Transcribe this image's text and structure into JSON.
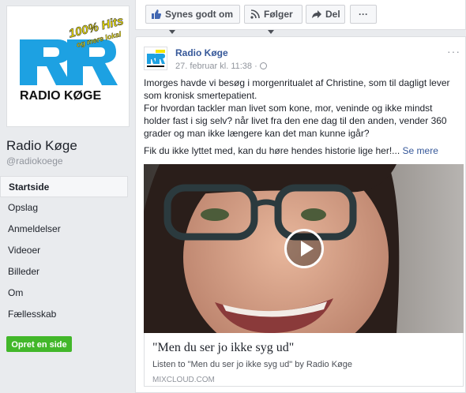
{
  "page": {
    "name": "Radio Køge",
    "handle": "@radiokoege"
  },
  "logo": {
    "slogan_line1": "100% Hits",
    "slogan_line2": "og mere lokal",
    "wordmark": "RADIO KØGE"
  },
  "nav": {
    "items": [
      {
        "label": "Startside",
        "active": true
      },
      {
        "label": "Opslag"
      },
      {
        "label": "Anmeldelser"
      },
      {
        "label": "Videoer"
      },
      {
        "label": "Billeder"
      },
      {
        "label": "Om"
      },
      {
        "label": "Fællesskab"
      }
    ],
    "create_button": "Opret en side"
  },
  "toolbar": {
    "like_label": "Synes godt om",
    "follow_label": "Følger",
    "share_label": "Del",
    "more_label": "···"
  },
  "post": {
    "author": "Radio Køge",
    "timestamp": "27. februar kl. 11:38 ·",
    "menu": "···",
    "paragraph1": "Imorges havde vi besøg i morgenritualet af Christine, som til dagligt lever som kronisk smertepatient.",
    "paragraph2": "For hvordan tackler man livet som kone, mor, veninde og ikke mindst holder fast i sig selv? når livet fra den ene dag til den anden, vender 360 grader og man ikke længere kan det man kunne igår?",
    "paragraph3": "Fik du ikke lyttet med, kan du høre hendes historie lige her!...",
    "see_more": "Se mere",
    "link": {
      "title": "\"Men du ser jo ikke syg ud\"",
      "description": "Listen to \"Men du ser jo ikke syg ud\" by Radio Køge",
      "domain": "MIXCLOUD.COM"
    }
  },
  "colors": {
    "fb_blue_link": "#365899",
    "logo_blue": "#1da1e2",
    "logo_yellow": "#f5e600",
    "create_green": "#42b72a"
  }
}
